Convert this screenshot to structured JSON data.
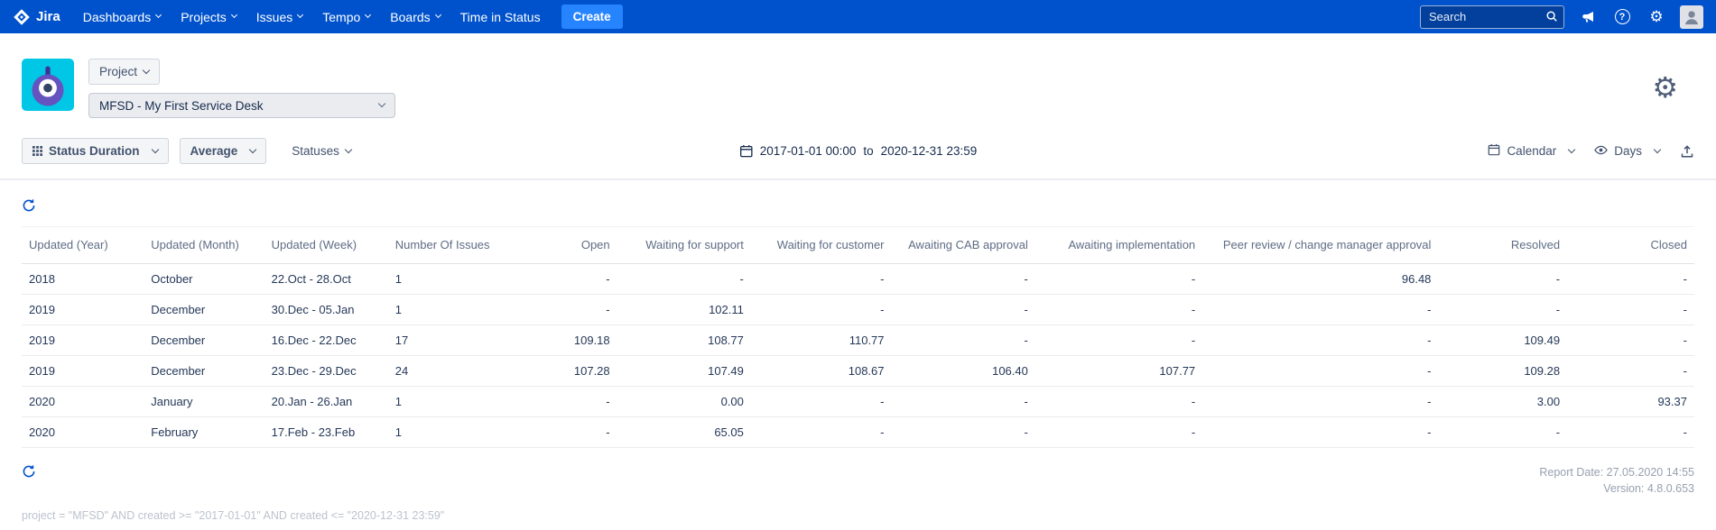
{
  "navbar": {
    "brand": "Jira",
    "items": [
      {
        "id": "dashboards",
        "label": "Dashboards",
        "chevron": true
      },
      {
        "id": "projects",
        "label": "Projects",
        "chevron": true
      },
      {
        "id": "issues",
        "label": "Issues",
        "chevron": true
      },
      {
        "id": "tempo",
        "label": "Tempo",
        "chevron": true
      },
      {
        "id": "boards",
        "label": "Boards",
        "chevron": true
      },
      {
        "id": "time-in-status",
        "label": "Time in Status",
        "chevron": false
      }
    ],
    "create_label": "Create",
    "search_placeholder": "Search"
  },
  "header": {
    "scope_label": "Project",
    "project_name": "MFSD - My First Service Desk"
  },
  "toolbar": {
    "report_type_label": "Status Duration",
    "aggregation_label": "Average",
    "statuses_label": "Statuses",
    "date_from": "2017-01-01 00:00",
    "date_separator": "to",
    "date_to": "2020-12-31 23:59",
    "calendar_label": "Calendar",
    "unit_label": "Days"
  },
  "table": {
    "columns": [
      "Updated (Year)",
      "Updated (Month)",
      "Updated (Week)",
      "Number Of Issues",
      "Open",
      "Waiting for support",
      "Waiting for customer",
      "Awaiting CAB approval",
      "Awaiting implementation",
      "Peer review / change manager approval",
      "Resolved",
      "Closed"
    ],
    "rows": [
      [
        "2018",
        "October",
        "22.Oct - 28.Oct",
        "1",
        "-",
        "-",
        "-",
        "-",
        "-",
        "96.48",
        "-",
        "-"
      ],
      [
        "2019",
        "December",
        "30.Dec - 05.Jan",
        "1",
        "-",
        "102.11",
        "-",
        "-",
        "-",
        "-",
        "-",
        "-"
      ],
      [
        "2019",
        "December",
        "16.Dec - 22.Dec",
        "17",
        "109.18",
        "108.77",
        "110.77",
        "-",
        "-",
        "-",
        "109.49",
        "-"
      ],
      [
        "2019",
        "December",
        "23.Dec - 29.Dec",
        "24",
        "107.28",
        "107.49",
        "108.67",
        "106.40",
        "107.77",
        "-",
        "109.28",
        "-"
      ],
      [
        "2020",
        "January",
        "20.Jan - 26.Jan",
        "1",
        "-",
        "0.00",
        "-",
        "-",
        "-",
        "-",
        "3.00",
        "93.37"
      ],
      [
        "2020",
        "February",
        "17.Feb - 23.Feb",
        "1",
        "-",
        "65.05",
        "-",
        "-",
        "-",
        "-",
        "-",
        "-"
      ]
    ]
  },
  "footer": {
    "report_date": "Report Date: 27.05.2020 14:55",
    "version": "Version: 4.8.0.653",
    "query": "project = \"MFSD\" AND created >= \"2017-01-01\" AND created <= \"2020-12-31 23:59\""
  },
  "colors": {
    "navbar": "#0052CC",
    "accent": "#0052CC",
    "create_button": "#2684FF",
    "text": "#172B4D",
    "muted": "#5E6C84"
  }
}
